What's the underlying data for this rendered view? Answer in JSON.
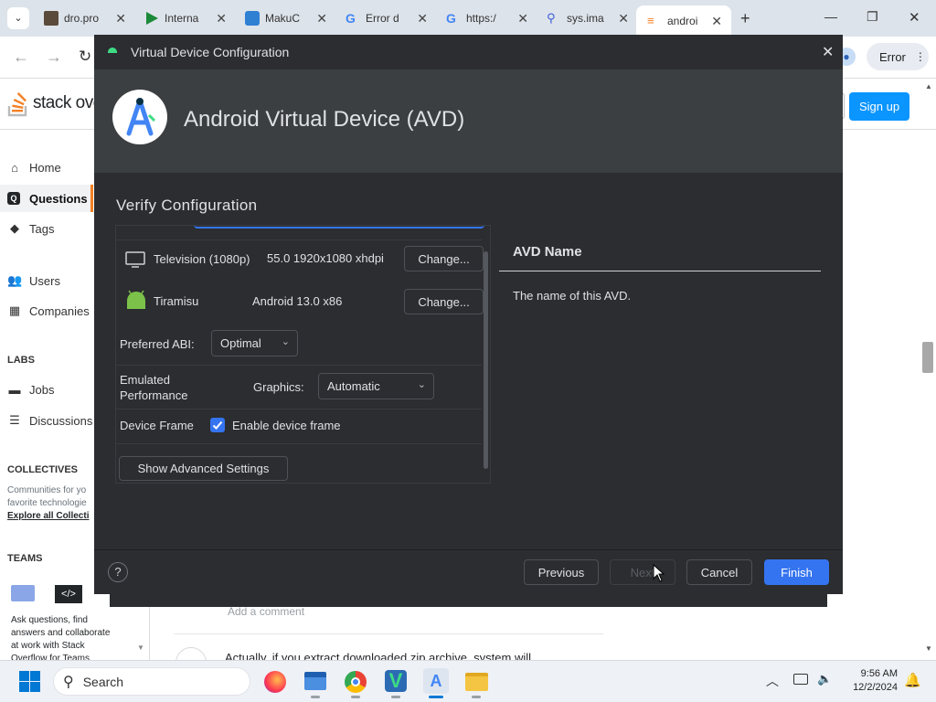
{
  "browser": {
    "tabs": [
      {
        "title": "dro.pro"
      },
      {
        "title": "Interna"
      },
      {
        "title": "MakuC"
      },
      {
        "title": "Error d"
      },
      {
        "title": "https:/"
      },
      {
        "title": "sys.ima"
      },
      {
        "title": "androi"
      }
    ],
    "error_label": "Error"
  },
  "so": {
    "logo_text": "stack ove",
    "signup": "Sign up",
    "nav": {
      "home": "Home",
      "questions": "Questions",
      "tags": "Tags",
      "users": "Users",
      "companies": "Companies",
      "labs_header": "LABS",
      "jobs": "Jobs",
      "discussions": "Discussions",
      "collectives_header": "COLLECTIVES",
      "collectives_text_1": "Communities for yo",
      "collectives_text_2": "favorite technologie",
      "collectives_link": "Explore all Collecti",
      "teams_header": "TEAMS",
      "teams_text_1": "Ask questions, find",
      "teams_text_2": "answers and collaborate",
      "teams_text_3": "at work with Stack",
      "teams_text_4": "Overflow for Teams"
    },
    "add_comment": "Add a comment",
    "answer_snippet": "Actually, if you extract downloaded zip archive, system will"
  },
  "dialog": {
    "window_title": "Virtual Device Configuration",
    "banner_title": "Android Virtual Device (AVD)",
    "section_title": "Verify Configuration",
    "device": {
      "name": "Television (1080p)",
      "spec": "55.0 1920x1080 xhdpi",
      "change": "Change..."
    },
    "system_image": {
      "name": "Tiramisu",
      "spec": "Android 13.0 x86",
      "change": "Change..."
    },
    "abi": {
      "label": "Preferred ABI:",
      "value": "Optimal"
    },
    "performance": {
      "label_1": "Emulated",
      "label_2": "Performance",
      "graphics_label": "Graphics:",
      "graphics_value": "Automatic"
    },
    "frame": {
      "label": "Device Frame",
      "checkbox_label": "Enable device frame",
      "checked": true
    },
    "advanced_button": "Show Advanced Settings",
    "help": {
      "title": "AVD Name",
      "text": "The name of this AVD."
    },
    "buttons": {
      "help": "?",
      "previous": "Previous",
      "next": "Next",
      "cancel": "Cancel",
      "finish": "Finish"
    }
  },
  "taskbar": {
    "search": "Search",
    "time": "9:56 AM",
    "date": "12/2/2024"
  },
  "colors": {
    "accent": "#3574f0",
    "so_orange": "#f48024",
    "so_blue": "#0a95ff",
    "android_green": "#3ddc84"
  }
}
